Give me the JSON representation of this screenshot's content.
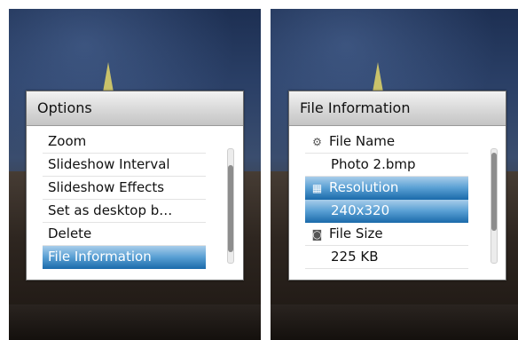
{
  "left_menu": {
    "title": "Options",
    "items": [
      {
        "label": "Zoom"
      },
      {
        "label": "Slideshow Interval"
      },
      {
        "label": "Slideshow Effects"
      },
      {
        "label": "Set as desktop b…"
      },
      {
        "label": "Delete"
      },
      {
        "label": "File Information",
        "selected": true
      }
    ]
  },
  "right_menu": {
    "title": "File Information",
    "rows": [
      {
        "icon": "file-name-icon",
        "label": "File Name"
      },
      {
        "value": "Photo 2.bmp"
      },
      {
        "icon": "resolution-icon",
        "label": "Resolution",
        "selected": true
      },
      {
        "value": "240x320",
        "selected": true
      },
      {
        "icon": "file-size-icon",
        "label": "File Size"
      },
      {
        "value": "225 KB"
      }
    ]
  },
  "colors": {
    "selection_top": "#a8cdea",
    "selection_bottom": "#1f6ead",
    "title_bar": "#d8d8d8"
  }
}
